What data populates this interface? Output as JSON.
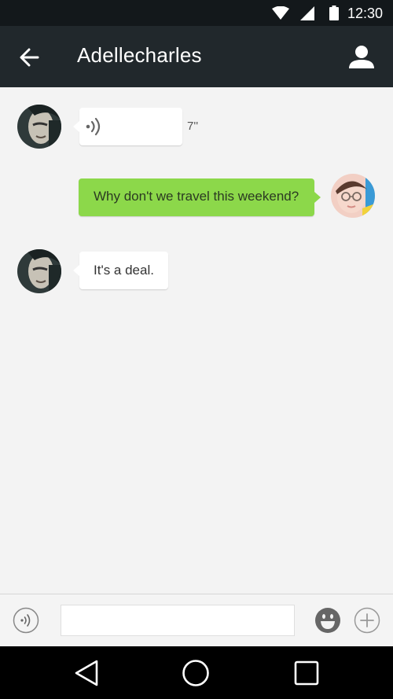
{
  "status_bar": {
    "time": "12:30",
    "icons": [
      "wifi-icon",
      "signal-icon",
      "battery-icon"
    ]
  },
  "toolbar": {
    "title": "Adellecharles",
    "back_icon": "arrow-left-icon",
    "profile_icon": "person-icon",
    "background": "#21282c"
  },
  "messages": [
    {
      "direction": "incoming",
      "kind": "voice",
      "duration": "7''"
    },
    {
      "direction": "outgoing",
      "kind": "text",
      "text": "Why don't we travel this weekend?"
    },
    {
      "direction": "incoming",
      "kind": "text",
      "text": "It's a deal."
    }
  ],
  "input_bar": {
    "voice_icon": "voice-icon",
    "input_value": "",
    "emoji_icon": "smiley-icon",
    "add_icon": "plus-icon"
  },
  "nav_bar": {
    "icons": [
      "back-triangle-icon",
      "home-circle-icon",
      "recents-square-icon"
    ]
  },
  "colors": {
    "outgoing_bubble": "#8cd84a",
    "incoming_bubble": "#ffffff",
    "chat_background": "#f3f3f3"
  }
}
